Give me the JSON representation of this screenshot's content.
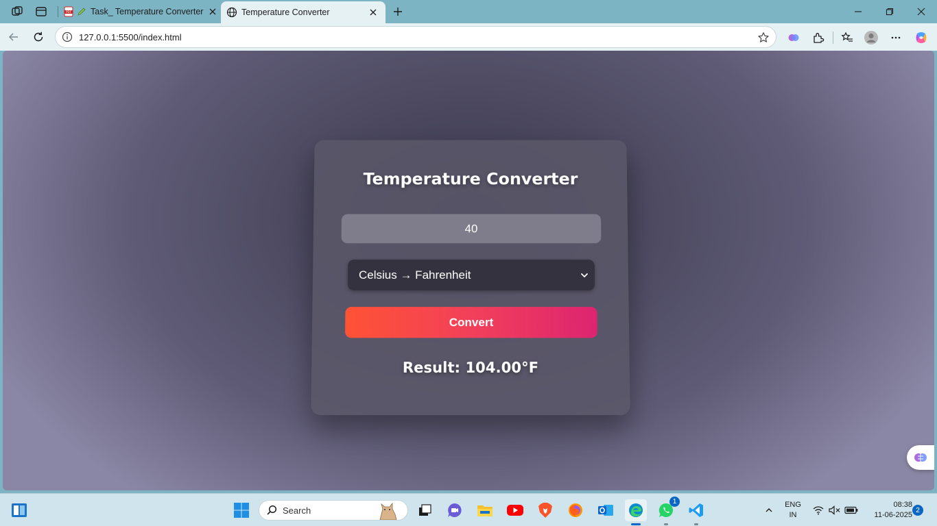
{
  "browser": {
    "tabs": [
      {
        "title": "Task_ Temperature Converter",
        "icon": "pdf-icon",
        "active": false
      },
      {
        "title": "Temperature Converter",
        "icon": "globe-icon",
        "active": true
      }
    ],
    "address": {
      "host": "127.0.0.1",
      "path": ":5500/index.html"
    }
  },
  "page": {
    "title": "Temperature Converter",
    "input_value": "40",
    "conversion_selected": "Celsius → Fahrenheit",
    "convert_label": "Convert",
    "result": "Result: 104.00°F"
  },
  "taskbar": {
    "search_placeholder": "Search",
    "whatsapp_badge": "1",
    "language": {
      "line1": "ENG",
      "line2": "IN"
    },
    "clock": {
      "time": "08:38",
      "date": "11-06-2025"
    },
    "notifications": "2"
  },
  "colors": {
    "accent_start": "#ff5235",
    "accent_end": "#dd2470",
    "card": "#5a5768",
    "input": "#7f7c8b",
    "select": "#34323f"
  }
}
